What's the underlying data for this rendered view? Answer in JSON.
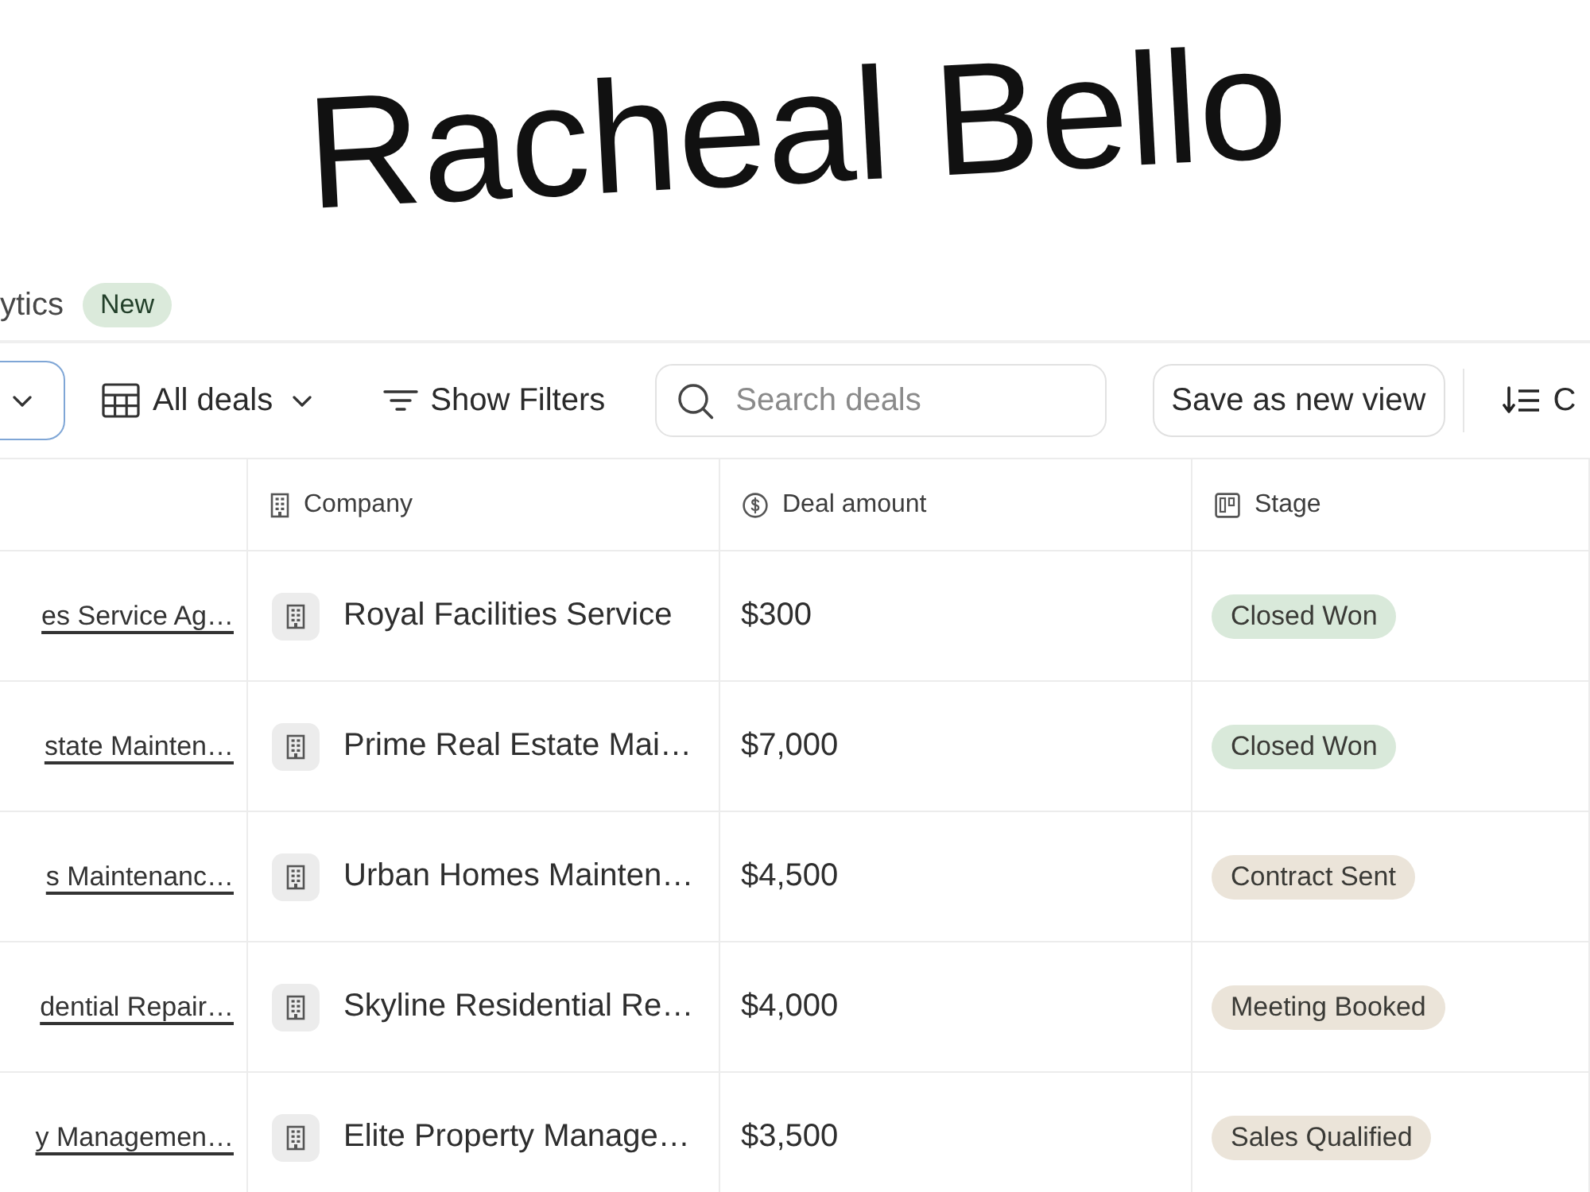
{
  "annotation": {
    "text": "Racheal Bello"
  },
  "header": {
    "title": "ytics",
    "badge": "New"
  },
  "toolbar": {
    "dropdown": {
      "focused": true
    },
    "view": {
      "label": "All deals"
    },
    "filter_button": {
      "label": "Show Filters"
    },
    "search": {
      "placeholder": "Search deals"
    },
    "save_button": {
      "label": "Save as new view"
    },
    "sort_button": {
      "label": "C"
    }
  },
  "table": {
    "columns": [
      {
        "kind": "company",
        "label": "Company"
      },
      {
        "kind": "amount",
        "label": "Deal amount"
      },
      {
        "kind": "stage",
        "label": "Stage"
      }
    ],
    "rows": [
      {
        "deal": "es Service Ag…",
        "company": "Royal Facilities Service",
        "amount": "$300",
        "stage": {
          "label": "Closed Won",
          "color": "#d9e9da"
        }
      },
      {
        "deal": "state Mainten…",
        "company": "Prime Real Estate Mai…",
        "amount": "$7,000",
        "stage": {
          "label": "Closed Won",
          "color": "#d9e9da"
        }
      },
      {
        "deal": "s Maintenanc…",
        "company": "Urban Homes Mainten…",
        "amount": "$4,500",
        "stage": {
          "label": "Contract Sent",
          "color": "#ebe4d9"
        }
      },
      {
        "deal": "dential Repair…",
        "company": "Skyline Residential Re…",
        "amount": "$4,000",
        "stage": {
          "label": "Meeting Booked",
          "color": "#ebe4d9"
        }
      },
      {
        "deal": "y Managemen…",
        "company": "Elite Property Manage…",
        "amount": "$3,500",
        "stage": {
          "label": "Sales Qualified",
          "color": "#ebe4d9"
        }
      }
    ]
  }
}
